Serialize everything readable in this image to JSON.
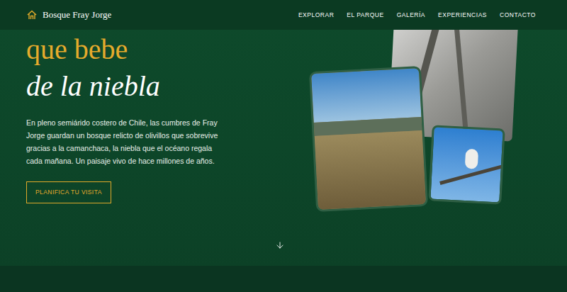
{
  "nav": {
    "brand": "Bosque Fray Jorge",
    "links": [
      "EXPLORAR",
      "EL PARQUE",
      "GALERÍA",
      "EXPERIENCIAS",
      "CONTACTO"
    ]
  },
  "hero": {
    "headline_line1": "que bebe",
    "headline_line2": "de la niebla",
    "paragraph": "En pleno semiárido costero de Chile, las cumbres de Fray Jorge guardan un bosque relicto de olivillos que sobrevive gracias a la camanchaca, la niebla que el océano regala cada mañana. Un paisaje vivo de hace millones de años.",
    "cta": "PLANIFICA TU VISITA"
  }
}
